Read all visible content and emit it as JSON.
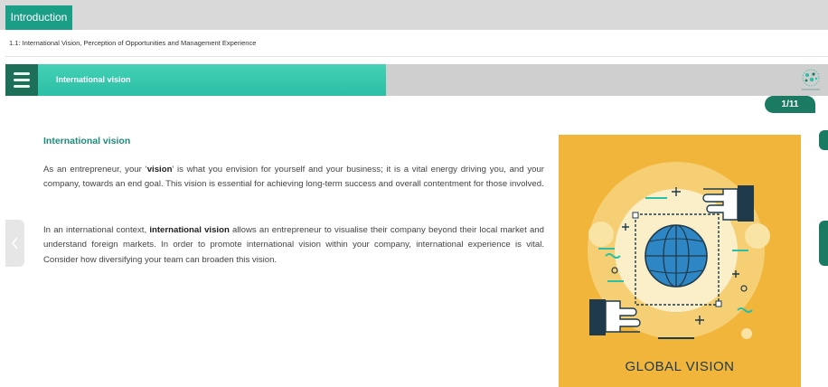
{
  "header": {
    "tab_label": "Introduction"
  },
  "breadcrumb": "1.1: International Vision, Perception of Opportunities and Management Experience",
  "titlebar": {
    "title": "International vision"
  },
  "pagination": {
    "current": 1,
    "total": 11,
    "label": "1/11"
  },
  "content": {
    "heading": "International vision",
    "para1": [
      "As an entrepreneur, your ‘",
      "vision",
      "’ is what you envision for yourself and your business; it is a vital energy driving you, and your company, towards an end goal. This vision is essential for achieving long-term success and overall contentment for those involved."
    ],
    "para2": [
      "In an international context, ",
      "international vision",
      " allows an entrepreneur to visualise their company beyond their local market and understand foreign markets. In order to promote international vision within your company, international experience is vital. Consider how diversifying your team can broaden this vision."
    ]
  },
  "illustration": {
    "caption": "GLOBAL VISION",
    "bg_color": "#f2b53b"
  },
  "colors": {
    "accent": "#1b9e86",
    "teal": "#2bbfa5",
    "dark_green": "#1b7a62"
  }
}
